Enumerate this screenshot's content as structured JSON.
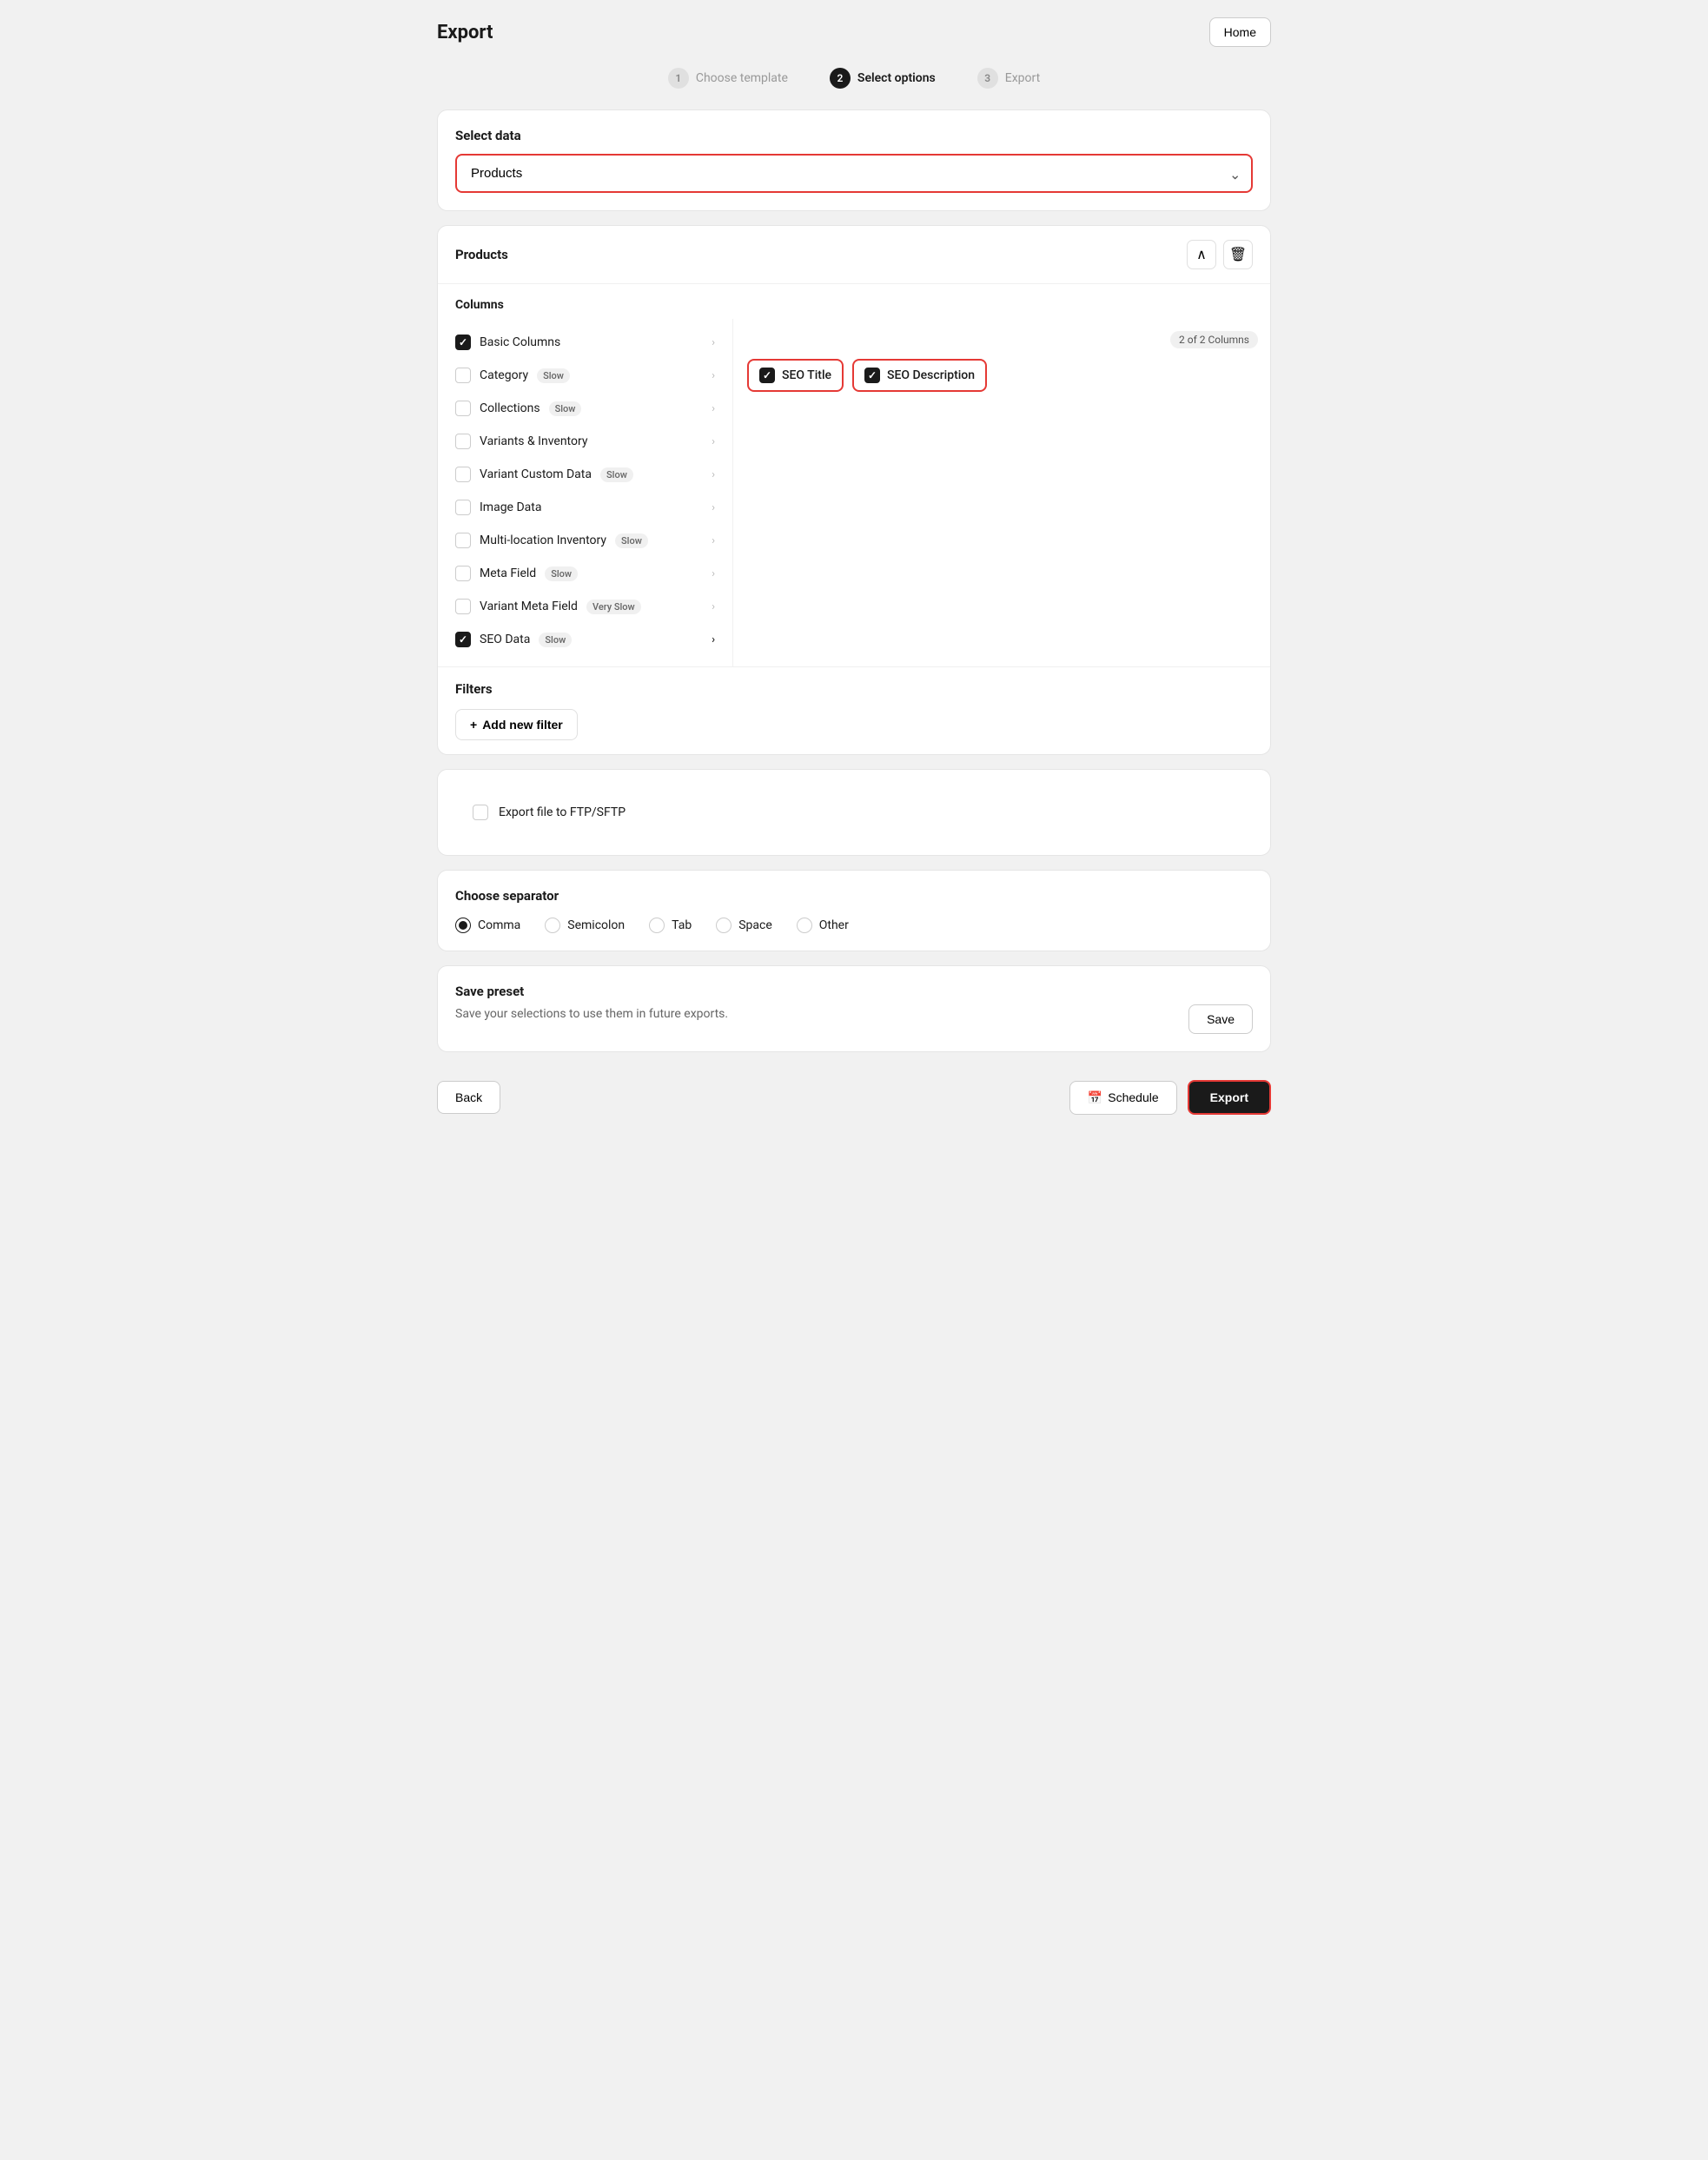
{
  "page": {
    "title": "Export",
    "home_button": "Home"
  },
  "stepper": {
    "steps": [
      {
        "number": "1",
        "label": "Choose template",
        "active": false
      },
      {
        "number": "2",
        "label": "Select options",
        "active": true
      },
      {
        "number": "3",
        "label": "Export",
        "active": false
      }
    ]
  },
  "select_data": {
    "label": "Select data",
    "value": "Products"
  },
  "products_section": {
    "title": "Products",
    "columns_label": "Columns",
    "columns_count": "2 of 2 Columns",
    "column_items": [
      {
        "id": "basic",
        "label": "Basic Columns",
        "checked": true,
        "badge": null,
        "active": false
      },
      {
        "id": "category",
        "label": "Category",
        "checked": false,
        "badge": "Slow",
        "active": false
      },
      {
        "id": "collections",
        "label": "Collections",
        "checked": false,
        "badge": "Slow",
        "active": false
      },
      {
        "id": "variants_inventory",
        "label": "Variants & Inventory",
        "checked": false,
        "badge": null,
        "active": false
      },
      {
        "id": "variant_custom_data",
        "label": "Variant Custom Data",
        "checked": false,
        "badge": "Slow",
        "active": false
      },
      {
        "id": "image_data",
        "label": "Image Data",
        "checked": false,
        "badge": null,
        "active": false
      },
      {
        "id": "multi_location",
        "label": "Multi-location Inventory",
        "checked": false,
        "badge": "Slow",
        "active": false
      },
      {
        "id": "meta_field",
        "label": "Meta Field",
        "checked": false,
        "badge": "Slow",
        "active": false
      },
      {
        "id": "variant_meta_field",
        "label": "Variant Meta Field",
        "checked": false,
        "badge": "Very Slow",
        "active": false
      },
      {
        "id": "seo_data",
        "label": "SEO Data",
        "checked": true,
        "badge": "Slow",
        "active": true
      }
    ],
    "sub_columns": [
      {
        "id": "seo_title",
        "label": "SEO Title",
        "checked": true
      },
      {
        "id": "seo_description",
        "label": "SEO Description",
        "checked": true
      }
    ]
  },
  "filters": {
    "title": "Filters",
    "add_button": "+ Add new filter"
  },
  "ftp": {
    "label": "Export file to FTP/SFTP"
  },
  "separator": {
    "title": "Choose separator",
    "options": [
      {
        "id": "comma",
        "label": "Comma",
        "selected": true
      },
      {
        "id": "semicolon",
        "label": "Semicolon",
        "selected": false
      },
      {
        "id": "tab",
        "label": "Tab",
        "selected": false
      },
      {
        "id": "space",
        "label": "Space",
        "selected": false
      },
      {
        "id": "other",
        "label": "Other",
        "selected": false
      }
    ]
  },
  "preset": {
    "title": "Save preset",
    "description": "Save your selections to use them in future exports.",
    "save_button": "Save"
  },
  "footer": {
    "back_button": "Back",
    "schedule_button": "Schedule",
    "export_button": "Export"
  }
}
